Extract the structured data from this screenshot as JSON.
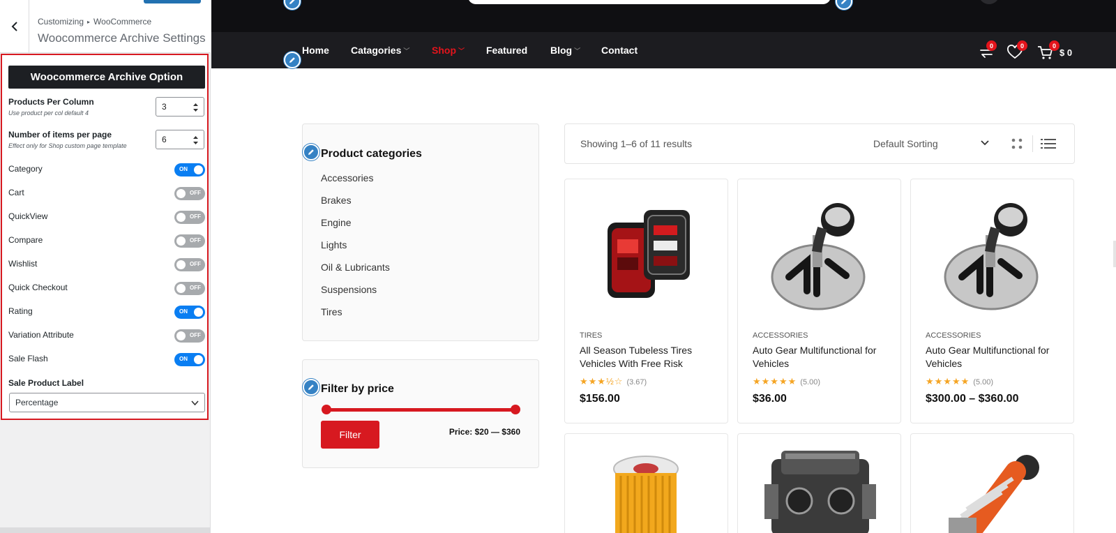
{
  "customizer": {
    "breadcrumb_root": "Customizing",
    "breadcrumb_child": "WooCommerce",
    "section_title": "Woocommerce Archive Settings",
    "options_header": "Woocommerce Archive Option",
    "products_per_column": {
      "label": "Products Per Column",
      "desc": "Use product per col default 4",
      "value": "3"
    },
    "items_per_page": {
      "label": "Number of items per page",
      "desc": "Effect only for Shop custom page template",
      "value": "6"
    },
    "toggles": [
      {
        "label": "Category",
        "state": "ON"
      },
      {
        "label": "Cart",
        "state": "OFF"
      },
      {
        "label": "QuickView",
        "state": "OFF"
      },
      {
        "label": "Compare",
        "state": "OFF"
      },
      {
        "label": "Wishlist",
        "state": "OFF"
      },
      {
        "label": "Quick Checkout",
        "state": "OFF"
      },
      {
        "label": "Rating",
        "state": "ON"
      },
      {
        "label": "Variation Attribute",
        "state": "OFF"
      },
      {
        "label": "Sale Flash",
        "state": "ON"
      }
    ],
    "sale_label": {
      "label": "Sale Product Label",
      "value": "Percentage"
    }
  },
  "nav": {
    "items": [
      "Home",
      "Catagories",
      "Shop",
      "Featured",
      "Blog",
      "Contact"
    ],
    "compare_count": "0",
    "wishlist_count": "0",
    "cart_count": "0",
    "cart_total": "$ 0"
  },
  "widgets": {
    "categories_title": "Product categories",
    "categories": [
      "Accessories",
      "Brakes",
      "Engine",
      "Lights",
      "Oil & Lubricants",
      "Suspensions",
      "Tires"
    ],
    "price_title": "Filter by price",
    "filter_label": "Filter",
    "price_range": "Price: $20 — $360"
  },
  "toolbar": {
    "result_count": "Showing 1–6 of 11 results",
    "sorting": "Default Sorting"
  },
  "products": [
    {
      "category": "TIRES",
      "name": "All Season Tubeless Tires Vehicles With Free Risk",
      "stars": "★★★½☆",
      "rating": "(3.67)",
      "price": "$156.00"
    },
    {
      "category": "ACCESSORIES",
      "name": "Auto Gear Multifunctional for Vehicles",
      "stars": "★★★★★",
      "rating": "(5.00)",
      "price": "$36.00"
    },
    {
      "category": "ACCESSORIES",
      "name": "Auto Gear Multifunctional for Vehicles",
      "stars": "★★★★★",
      "rating": "(5.00)",
      "price": "$300.00 – $360.00"
    }
  ],
  "colors": {
    "accent_red": "#d71920",
    "toggle_on": "#0a7ef2",
    "toggle_off": "#a7aaad",
    "nav_bg": "#1c1c20",
    "edit_blue": "#3582c4"
  }
}
